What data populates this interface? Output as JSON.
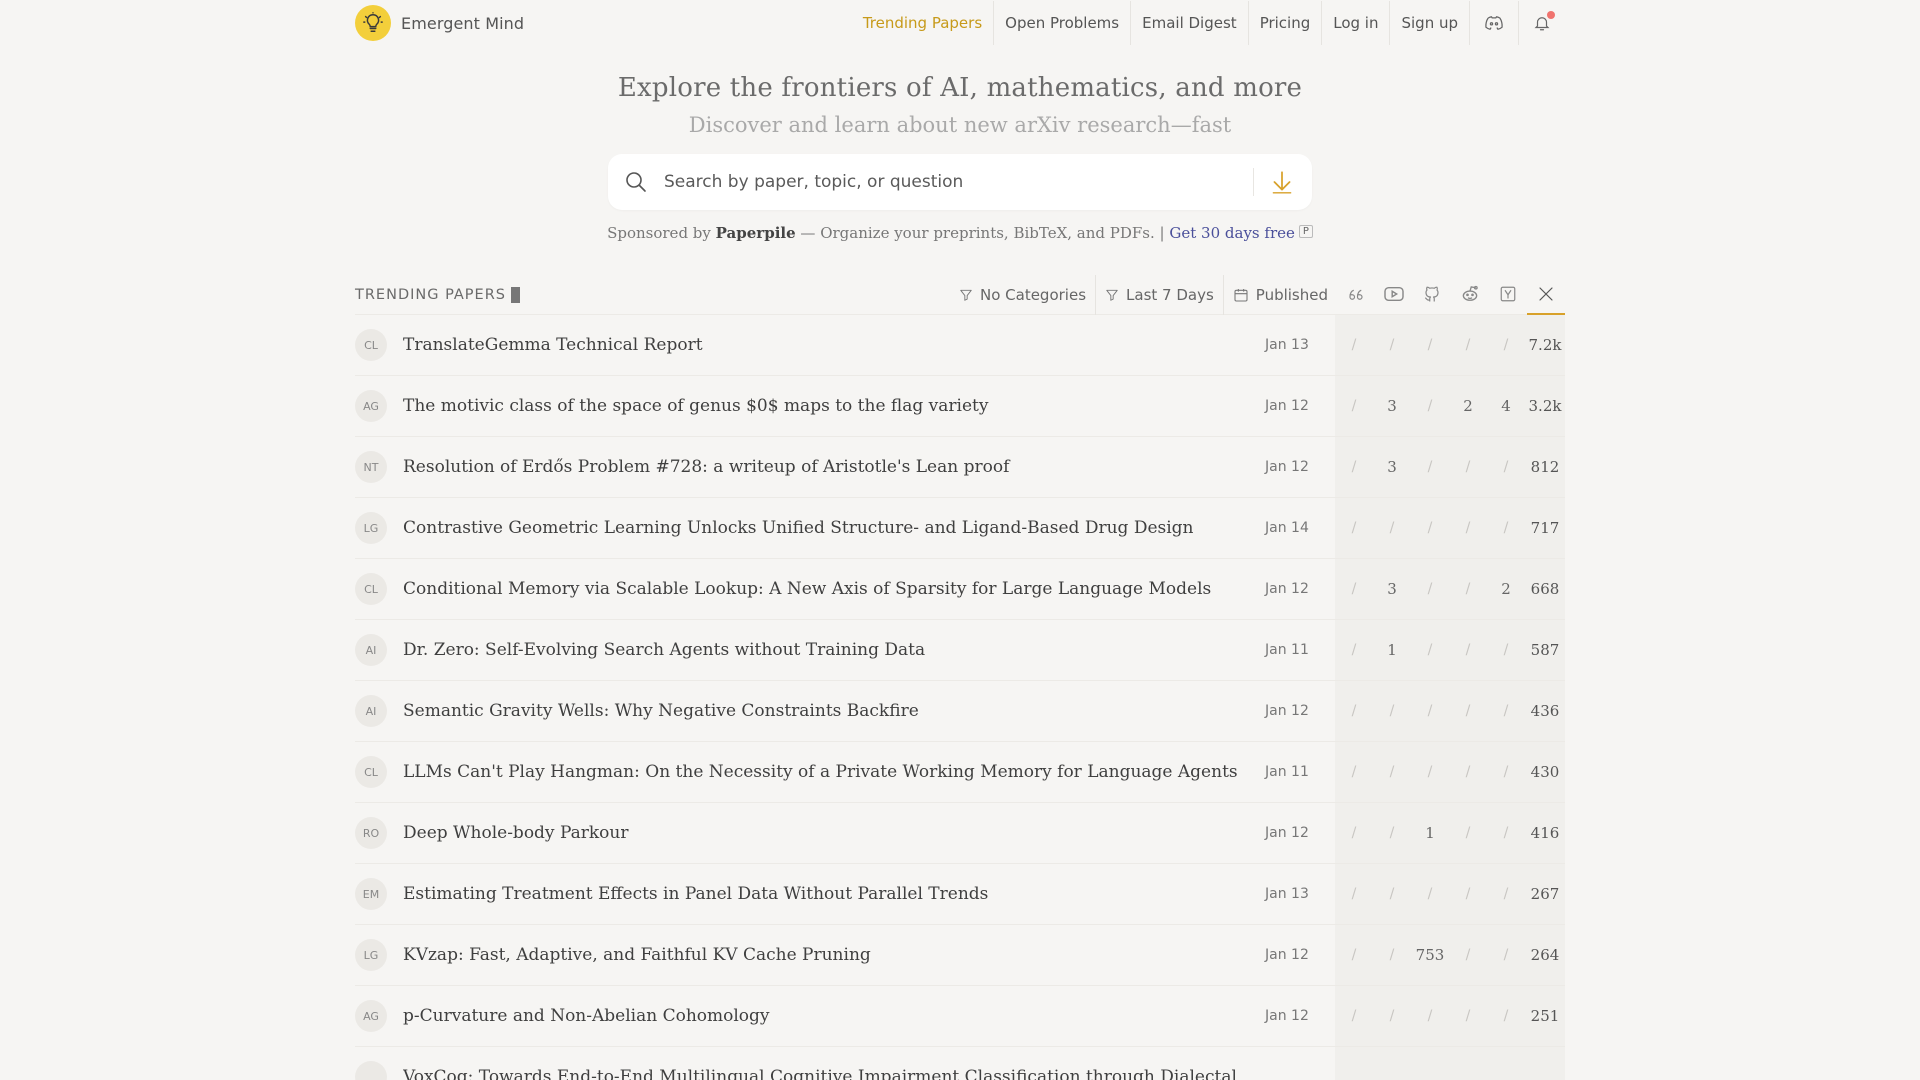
{
  "brand": {
    "name": "Emergent Mind"
  },
  "nav": {
    "links": [
      "Trending Papers",
      "Open Problems",
      "Email Digest",
      "Pricing",
      "Log in",
      "Sign up"
    ],
    "active": "Trending Papers"
  },
  "hero": {
    "title": "Explore the frontiers of AI, mathematics, and more",
    "subtitle": "Discover and learn about new arXiv research—fast"
  },
  "search": {
    "placeholder": "Search by paper, topic, or question"
  },
  "sponsor": {
    "prefix": "Sponsored by",
    "name": "Paperpile",
    "text": "— Organize your preprints, BibTeX, and PDFs. |",
    "link": "Get 30 days free",
    "badge": "P"
  },
  "trending": {
    "label": "TRENDING PAPERS",
    "filters": {
      "categories": "No Categories",
      "range": "Last 7 Days",
      "date_mode": "Published"
    },
    "source_icons": [
      "quote-icon",
      "youtube-icon",
      "github-icon",
      "reddit-icon",
      "hackernews-icon",
      "x-icon"
    ],
    "active_source": "x-icon"
  },
  "papers": [
    {
      "cat": "CL",
      "title": "TranslateGemma Technical Report",
      "date": "Jan 13",
      "m": [
        "/",
        "/",
        "/",
        "/",
        "/"
      ],
      "score": "7.2k"
    },
    {
      "cat": "AG",
      "title": "The motivic class of the space of genus $0$ maps to the flag variety",
      "date": "Jan 12",
      "m": [
        "/",
        "3",
        "/",
        "2",
        "4"
      ],
      "score": "3.2k"
    },
    {
      "cat": "NT",
      "title": "Resolution of Erdős Problem #728: a writeup of Aristotle's Lean proof",
      "date": "Jan 12",
      "m": [
        "/",
        "3",
        "/",
        "/",
        "/"
      ],
      "score": "812"
    },
    {
      "cat": "LG",
      "title": "Contrastive Geometric Learning Unlocks Unified Structure- and Ligand-Based Drug Design",
      "date": "Jan 14",
      "m": [
        "/",
        "/",
        "/",
        "/",
        "/"
      ],
      "score": "717"
    },
    {
      "cat": "CL",
      "title": "Conditional Memory via Scalable Lookup: A New Axis of Sparsity for Large Language Models",
      "date": "Jan 12",
      "m": [
        "/",
        "3",
        "/",
        "/",
        "2"
      ],
      "score": "668"
    },
    {
      "cat": "AI",
      "title": "Dr. Zero: Self-Evolving Search Agents without Training Data",
      "date": "Jan 11",
      "m": [
        "/",
        "1",
        "/",
        "/",
        "/"
      ],
      "score": "587"
    },
    {
      "cat": "AI",
      "title": "Semantic Gravity Wells: Why Negative Constraints Backfire",
      "date": "Jan 12",
      "m": [
        "/",
        "/",
        "/",
        "/",
        "/"
      ],
      "score": "436"
    },
    {
      "cat": "CL",
      "title": "LLMs Can't Play Hangman: On the Necessity of a Private Working Memory for Language Agents",
      "date": "Jan 11",
      "m": [
        "/",
        "/",
        "/",
        "/",
        "/"
      ],
      "score": "430"
    },
    {
      "cat": "RO",
      "title": "Deep Whole-body Parkour",
      "date": "Jan 12",
      "m": [
        "/",
        "/",
        "1",
        "/",
        "/"
      ],
      "score": "416"
    },
    {
      "cat": "EM",
      "title": "Estimating Treatment Effects in Panel Data Without Parallel Trends",
      "date": "Jan 13",
      "m": [
        "/",
        "/",
        "/",
        "/",
        "/"
      ],
      "score": "267"
    },
    {
      "cat": "LG",
      "title": "KVzap: Fast, Adaptive, and Faithful KV Cache Pruning",
      "date": "Jan 12",
      "m": [
        "/",
        "/",
        "753",
        "/",
        "/"
      ],
      "score": "264"
    },
    {
      "cat": "AG",
      "title": "p-Curvature and Non-Abelian Cohomology",
      "date": "Jan 12",
      "m": [
        "/",
        "/",
        "/",
        "/",
        "/"
      ],
      "score": "251"
    },
    {
      "cat": "",
      "title": "VoxCog: Towards End-to-End Multilingual Cognitive Impairment Classification through Dialectal",
      "date": "",
      "m": [
        "",
        "",
        "",
        "",
        ""
      ],
      "score": ""
    }
  ],
  "colors": {
    "accent": "#c79a1a",
    "background": "#f6f5f3",
    "link": "#4a4f9a",
    "logo": "#f3cf3b"
  }
}
